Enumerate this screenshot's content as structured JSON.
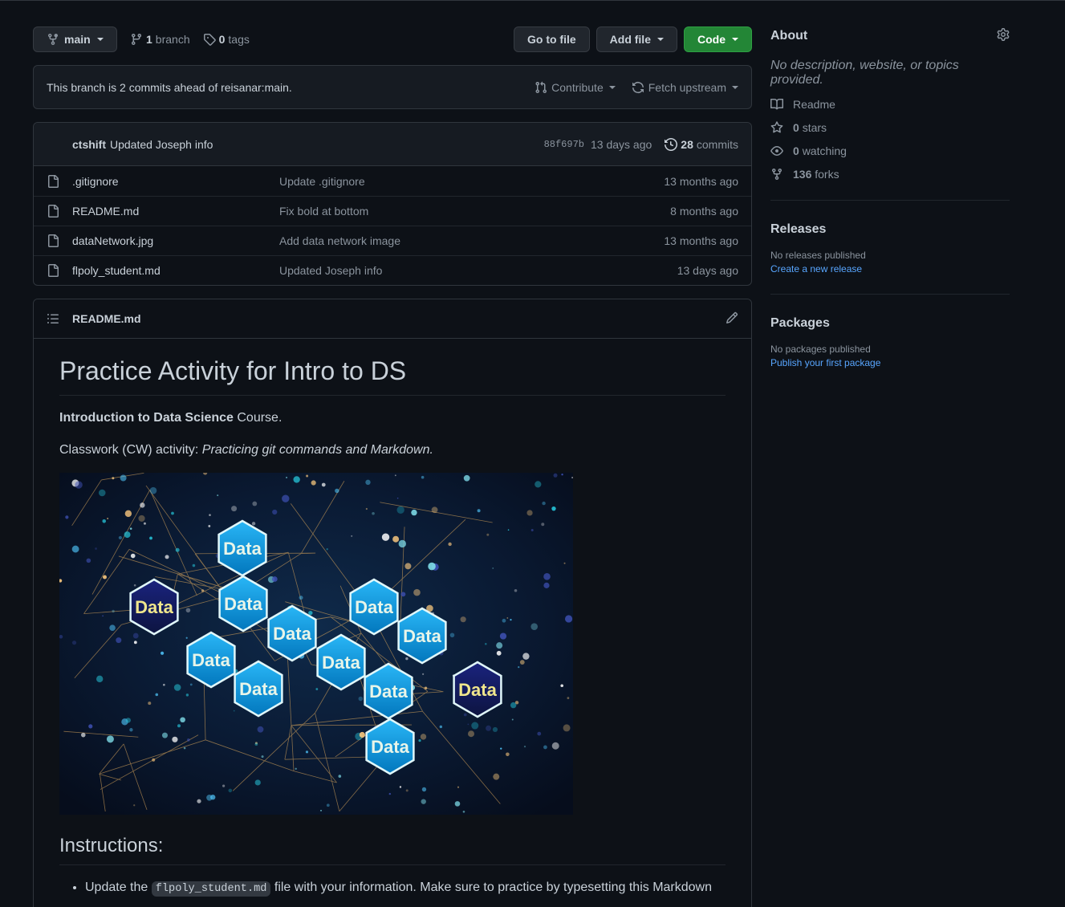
{
  "toolbar": {
    "branch_name": "main",
    "branches_count": "1",
    "branches_label": "branch",
    "tags_count": "0",
    "tags_label": "tags",
    "go_to_file": "Go to file",
    "add_file": "Add file",
    "code": "Code"
  },
  "ahead": {
    "text": "This branch is 2 commits ahead of reisanar:main.",
    "contribute": "Contribute",
    "fetch_upstream": "Fetch upstream"
  },
  "latest_commit": {
    "author": "ctshift",
    "message": "Updated Joseph info",
    "sha": "88f697b",
    "age": "13 days ago",
    "commits_count": "28",
    "commits_label": "commits"
  },
  "files": [
    {
      "name": ".gitignore",
      "message": "Update .gitignore",
      "age": "13 months ago"
    },
    {
      "name": "README.md",
      "message": "Fix bold at bottom",
      "age": "8 months ago"
    },
    {
      "name": "dataNetwork.jpg",
      "message": "Add data network image",
      "age": "13 months ago"
    },
    {
      "name": "flpoly_student.md",
      "message": "Updated Joseph info",
      "age": "13 days ago"
    }
  ],
  "readme": {
    "filename": "README.md",
    "h1": "Practice Activity for Intro to DS",
    "p1_bold": "Introduction to Data Science",
    "p1_rest": " Course.",
    "p2_lead": "Classwork (CW) activity: ",
    "p2_em": "Practicing git commands and Markdown.",
    "image_hex_label": "Data",
    "h2": "Instructions:",
    "bullet_lead": "Update the ",
    "bullet_code": "flpoly_student.md",
    "bullet_rest": " file with your information. Make sure to practice by typesetting this Markdown"
  },
  "about": {
    "title": "About",
    "description": "No description, website, or topics provided.",
    "readme": "Readme",
    "stars_count": "0",
    "stars_label": "stars",
    "watching_count": "0",
    "watching_label": "watching",
    "forks_count": "136",
    "forks_label": "forks"
  },
  "releases": {
    "title": "Releases",
    "none": "No releases published",
    "link": "Create a new release"
  },
  "packages": {
    "title": "Packages",
    "none": "No packages published",
    "link": "Publish your first package"
  },
  "colors": {
    "background": "#0d1117",
    "accent_green": "#238636",
    "link_blue": "#58a6ff"
  }
}
